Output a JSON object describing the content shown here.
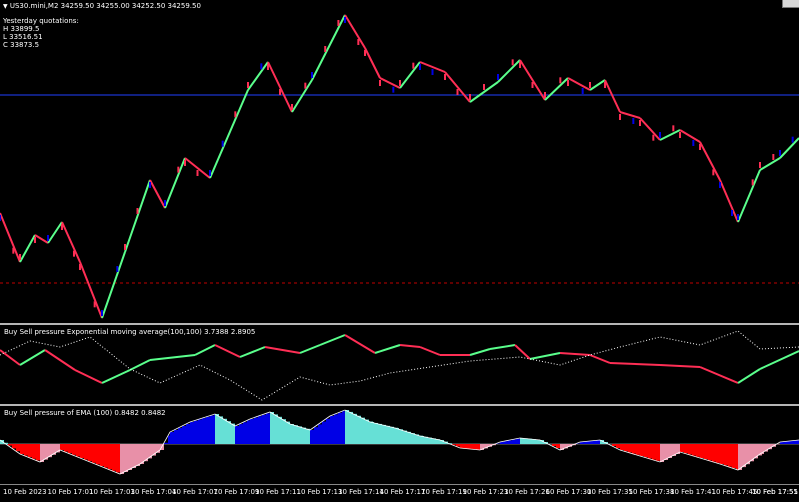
{
  "main": {
    "symbol_info": "US30.mini,M2  34259.50  34255.00  34252.50  34259.50",
    "yesterday_title": "Yesterday quotations:",
    "high": "H 33899.5",
    "low": "L 33516.51",
    "close": "C 33873.5"
  },
  "indicator1": {
    "title": "Buy Sell pressure Exponential moving average(100,100) 3.7388 2.8905"
  },
  "indicator2": {
    "title": "Buy Sell pressure of EMA (100) 0.8482 0.8482"
  },
  "time_axis": [
    "10 Feb 2023",
    "10 Feb 17:01",
    "10 Feb 17:03",
    "10 Feb 17:04",
    "10 Feb 17:07",
    "10 Feb 17:09",
    "10 Feb 17:11",
    "10 Feb 17:13",
    "10 Feb 17:14",
    "10 Feb 17:17",
    "10 Feb 17:19",
    "10 Feb 17:23",
    "10 Feb 17:26",
    "10 Feb 17:30",
    "10 Feb 17:35",
    "10 Feb 17:38",
    "10 Feb 17:41",
    "10 Feb 17:45",
    "10 Feb 17:51",
    "10 Feb 17:55"
  ],
  "colors": {
    "rise": "#5aff8c",
    "fall": "#ff2e55",
    "hist_blue": "#0000e6",
    "hist_cyan": "#66e0d6",
    "hist_red": "#ff0000",
    "hist_pink": "#e890a8",
    "level_line": "#2040ff",
    "level_dashed": "#c00000"
  }
}
